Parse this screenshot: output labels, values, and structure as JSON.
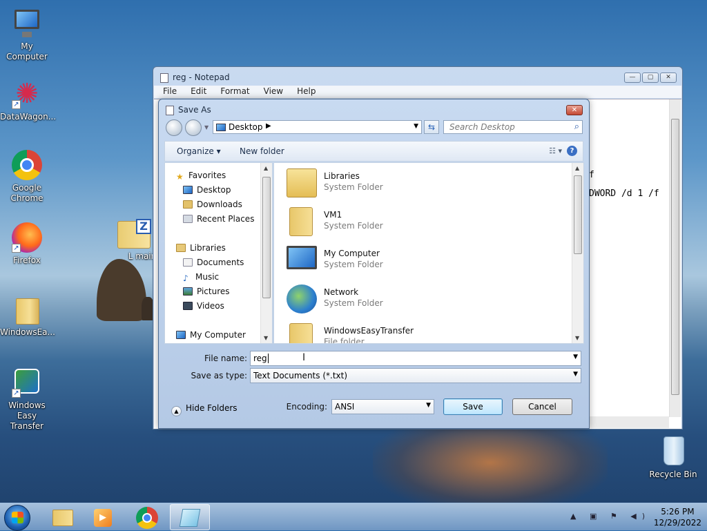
{
  "desktop": {
    "icons": [
      {
        "label": "My Computer"
      },
      {
        "label": "DataWagon..."
      },
      {
        "label": "Google Chrome"
      },
      {
        "label": "Firefox"
      },
      {
        "label": "WindowsEa..."
      },
      {
        "label": "Windows Easy Transfer"
      },
      {
        "label": "L main"
      },
      {
        "label": "Recycle Bin"
      }
    ]
  },
  "notepad": {
    "title": "reg - Notepad",
    "menu": [
      "File",
      "Edit",
      "Format",
      "View",
      "Help"
    ],
    "text_lines": [
      "f",
      "DWORD /d 1 /f"
    ]
  },
  "dialog": {
    "title": "Save As",
    "address": "Desktop",
    "search_placeholder": "Search Desktop",
    "toolbar": {
      "organize": "Organize ▾",
      "new_folder": "New folder"
    },
    "nav": {
      "favorites": "Favorites",
      "desktop": "Desktop",
      "downloads": "Downloads",
      "recent": "Recent Places",
      "libraries": "Libraries",
      "documents": "Documents",
      "music": "Music",
      "pictures": "Pictures",
      "videos": "Videos",
      "computer": "My Computer"
    },
    "files": [
      {
        "name": "Libraries",
        "type": "System Folder"
      },
      {
        "name": "VM1",
        "type": "System Folder"
      },
      {
        "name": "My Computer",
        "type": "System Folder"
      },
      {
        "name": "Network",
        "type": "System Folder"
      },
      {
        "name": "WindowsEasyTransfer",
        "type": "File folder"
      }
    ],
    "filename_label": "File name:",
    "filename_value": "reg",
    "savetype_label": "Save as type:",
    "savetype_value": "Text Documents (*.txt)",
    "hide_folders": "Hide Folders",
    "encoding_label": "Encoding:",
    "encoding_value": "ANSI",
    "save": "Save",
    "cancel": "Cancel"
  },
  "taskbar": {
    "time": "5:26 PM",
    "date": "12/29/2022"
  }
}
